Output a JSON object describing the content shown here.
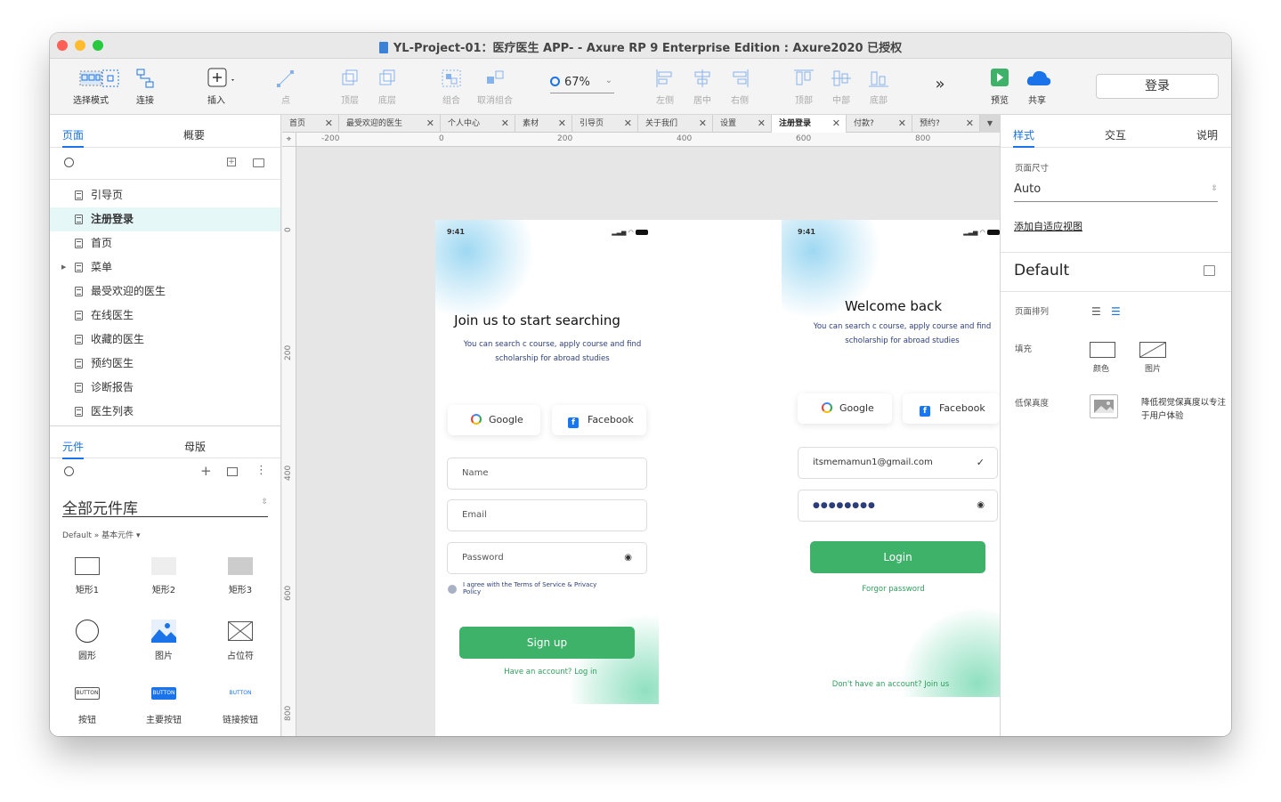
{
  "window": {
    "title": "YL-Project-01：医疗医生 APP- - Axure RP 9 Enterprise Edition : Axure2020 已授权"
  },
  "toolbar": {
    "select_mode": "选择模式",
    "connect": "连接",
    "insert": "插入",
    "point": "点",
    "top_layer": "顶层",
    "bottom_layer": "底层",
    "group": "组合",
    "ungroup": "取消组合",
    "zoom": "67%",
    "align_left": "左侧",
    "align_center": "居中",
    "align_right": "右侧",
    "align_top": "顶部",
    "align_middle": "中部",
    "align_bottom": "底部",
    "preview": "预览",
    "share": "共享",
    "login": "登录"
  },
  "left_panel": {
    "tab_pages": "页面",
    "tab_outline": "概要",
    "pages": [
      "引导页",
      "注册登录",
      "首页",
      "菜单",
      "最受欢迎的医生",
      "在线医生",
      "收藏的医生",
      "预约医生",
      "诊断报告",
      "医生列表"
    ],
    "tab_widgets": "元件",
    "tab_masters": "母版",
    "library_title": "全部元件库",
    "library_path": "Default » 基本元件 ▾",
    "components": [
      "矩形1",
      "矩形2",
      "矩形3",
      "圆形",
      "图片",
      "占位符",
      "按钮",
      "主要按钮",
      "链接按钮"
    ],
    "button_text": "BUTTON"
  },
  "doc_tabs": [
    "首页",
    "最受欢迎的医生",
    "个人中心",
    "素材",
    "引导页",
    "关于我们",
    "设置",
    "注册登录",
    "付款?",
    "预约?"
  ],
  "ruler": {
    "h": [
      "-200",
      "0",
      "200",
      "400",
      "600",
      "800"
    ],
    "v": [
      "0",
      "200",
      "400",
      "600",
      "800"
    ]
  },
  "phone_signup": {
    "time": "9:41",
    "title": "Join us to start searching",
    "subtitle1": "You can search c course, apply course and find",
    "subtitle2": "scholarship for abroad studies",
    "google": "Google",
    "facebook": "Facebook",
    "name_ph": "Name",
    "email_ph": "Email",
    "password_ph": "Password",
    "agree1": "I agree with the Terms of Service & Privacy",
    "agree2": "Policy",
    "signup": "Sign up",
    "have_account": "Have an account? Log in"
  },
  "phone_login": {
    "time": "9:41",
    "title": "Welcome back",
    "subtitle1": "You can search c course, apply course and find",
    "subtitle2": "scholarship for abroad studies",
    "google": "Google",
    "facebook": "Facebook",
    "email_value": "itsmemamun1@gmail.com",
    "password_value": "●●●●●●●●",
    "login": "Login",
    "forgot": "Forgor password",
    "no_account": "Don't have an account? Join us"
  },
  "right_panel": {
    "tab_style": "样式",
    "tab_interaction": "交互",
    "tab_notes": "说明",
    "page_size_label": "页面尺寸",
    "page_size_value": "Auto",
    "add_adaptive": "添加自适应视图",
    "default_label": "Default",
    "page_align_label": "页面排列",
    "fill_label": "填充",
    "fill_color": "颜色",
    "fill_image": "图片",
    "low_fidelity_label": "低保真度",
    "low_fidelity_desc1": "降低视觉保真度以专注",
    "low_fidelity_desc2": "于用户体验"
  },
  "colors": {
    "accent": "#1a73e8",
    "green": "#3fb26a"
  }
}
